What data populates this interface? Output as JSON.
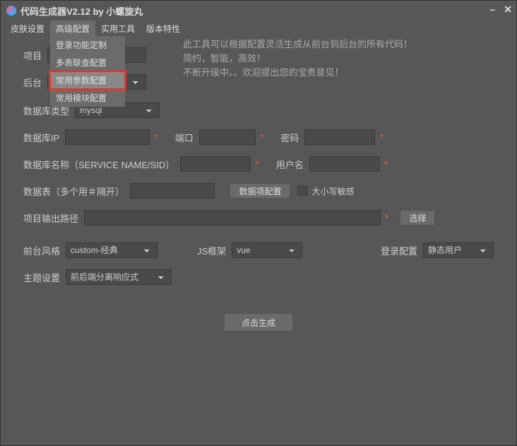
{
  "title": "代码生成器V2.12 by 小螺旋丸",
  "tabs": [
    "皮肤设置",
    "高级配置",
    "实用工具",
    "版本特性"
  ],
  "dropdown": {
    "items": [
      "登录功能定制",
      "多表联查配置",
      "常用参数配置",
      "常用模块配置"
    ],
    "highlighted_index": 2
  },
  "intro": {
    "line1": "此工具可以根据配置灵活生成从前台到后台的所有代码！",
    "line2": "简约，智能，高效！",
    "line3": "不断升级中。。欢迎提出您的宝贵意见！"
  },
  "labels": {
    "project": "项目",
    "backend": "后台",
    "db_type": "数据库类型",
    "db_ip": "数据库IP",
    "port": "端口",
    "password": "密码",
    "db_name": "数据库名称（SERVICE NAME/SID）",
    "username": "用户名",
    "tables": "数据表（多个用＃隔开）",
    "columns_btn": "数据项配置",
    "case_sensitive": "大小写敏感",
    "output_path": "项目输出路径",
    "select_btn": "选择",
    "frontend_style": "前台风格",
    "js_framework": "JS框架",
    "login_config": "登录配置",
    "theme": "主题设置",
    "generate": "点击生成"
  },
  "values": {
    "db_type": "mysql",
    "frontend_style": "custom-经典",
    "js_framework": "vue",
    "login_config": "静态用户",
    "theme": "前后端分离响应式"
  }
}
